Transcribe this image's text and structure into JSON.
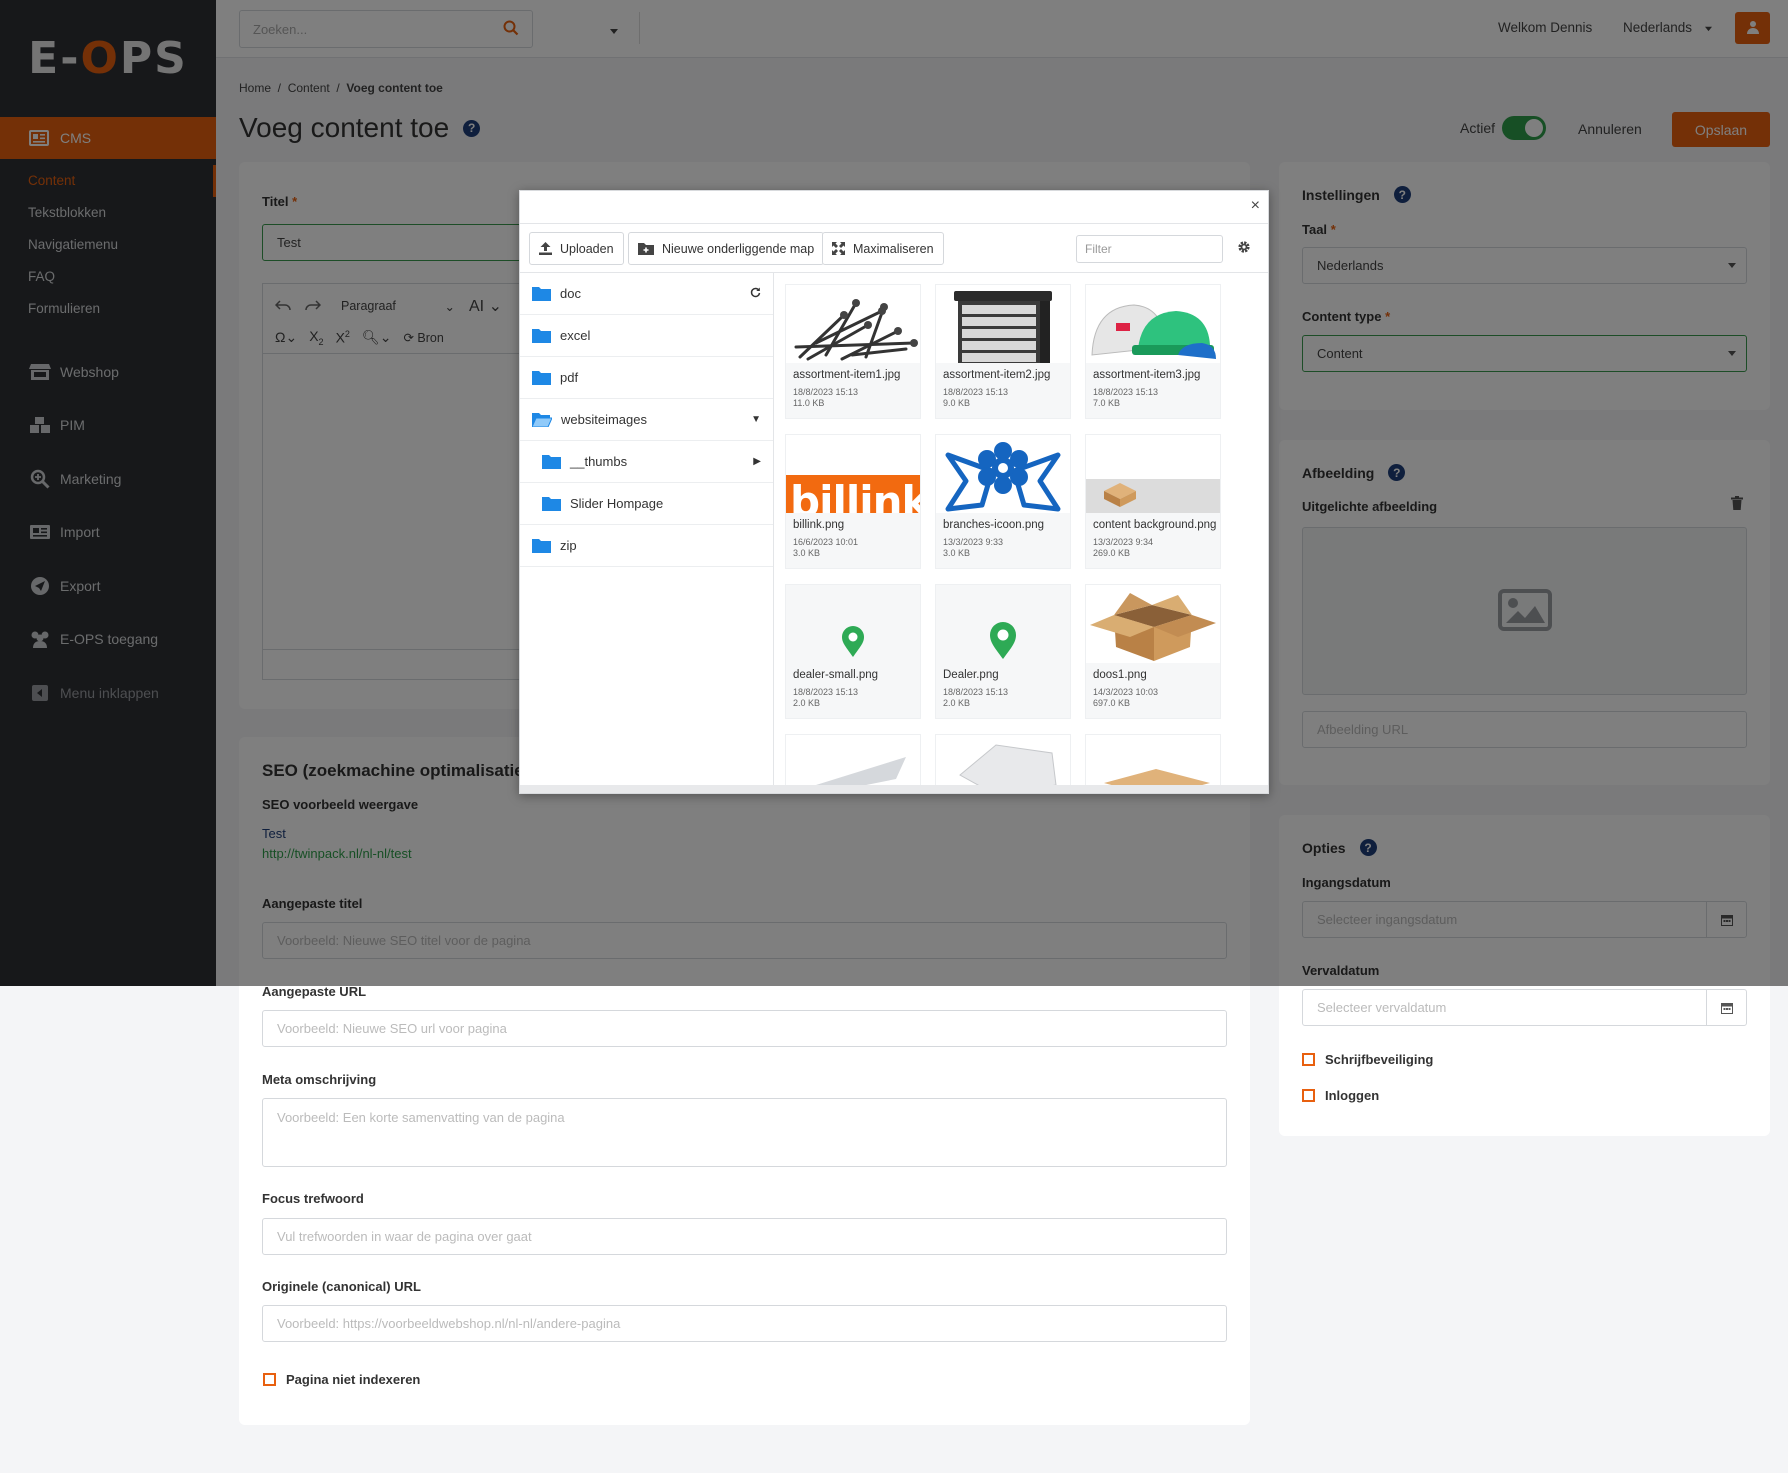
{
  "brand": {
    "logo_left": "E-",
    "logo_o": "O",
    "logo_right": "PS",
    "accent": "#e8600f",
    "sidebar_bg": "#2f3135"
  },
  "sidebar": {
    "cms_label": "CMS",
    "cms_items": [
      "Content",
      "Tekstblokken",
      "Navigatiemenu",
      "FAQ",
      "Formulieren"
    ],
    "main_items": [
      "Webshop",
      "PIM",
      "Marketing",
      "Import",
      "Export",
      "E-OPS toegang"
    ],
    "collapse_label": "Menu inklappen"
  },
  "topbar": {
    "search_placeholder": "Zoeken...",
    "welcome": "Welkom Dennis",
    "language": "Nederlands"
  },
  "breadcrumb": {
    "home": "Home",
    "content": "Content",
    "current": "Voeg content toe"
  },
  "header": {
    "title": "Voeg content toe",
    "help": "?",
    "actief_label": "Actief",
    "actief_on": true,
    "cancel": "Annuleren",
    "save": "Opslaan"
  },
  "main_form": {
    "title_label": "Titel",
    "required": "*",
    "title_value": "Test",
    "editor": {
      "paragraph": "Paragraaf",
      "font_size": "AI",
      "source": "Bron"
    }
  },
  "seo": {
    "heading": "SEO (zoekmachine optimalisatie)",
    "preview_label": "SEO voorbeeld weergave",
    "preview_title": "Test",
    "preview_url": "http://twinpack.nl/nl-nl/test",
    "custom_title_label": "Aangepaste titel",
    "custom_title_placeholder": "Voorbeeld: Nieuwe SEO titel voor de pagina",
    "custom_url_label": "Aangepaste URL",
    "custom_url_placeholder": "Voorbeeld: Nieuwe SEO url voor pagina",
    "meta_label": "Meta omschrijving",
    "meta_placeholder": "Voorbeeld: Een korte samenvatting van de pagina",
    "focus_label": "Focus trefwoord",
    "focus_placeholder": "Vul trefwoorden in waar de pagina over gaat",
    "canonical_label": "Originele (canonical) URL",
    "canonical_placeholder": "Voorbeeld: https://voorbeeldwebshop.nl/nl-nl/andere-pagina",
    "noindex_label": "Pagina niet indexeren"
  },
  "settings": {
    "heading": "Instellingen",
    "taal_label": "Taal",
    "taal_value": "Nederlands",
    "content_type_label": "Content type",
    "content_type_value": "Content"
  },
  "image_card": {
    "heading": "Afbeelding",
    "featured_label": "Uitgelichte afbeelding",
    "url_placeholder": "Afbeelding URL"
  },
  "options": {
    "heading": "Opties",
    "start_label": "Ingangsdatum",
    "start_placeholder": "Selecteer ingangsdatum",
    "end_label": "Vervaldatum",
    "end_placeholder": "Selecteer vervaldatum",
    "write_protect": "Schrijfbeveiliging",
    "login": "Inloggen"
  },
  "modal": {
    "close": "×",
    "upload": "Uploaden",
    "new_folder": "Nieuwe onderliggende map",
    "maximize": "Maximaliseren",
    "filter_placeholder": "Filter",
    "folders": [
      {
        "name": "doc"
      },
      {
        "name": "excel"
      },
      {
        "name": "pdf"
      },
      {
        "name": "websiteimages"
      },
      {
        "name": "__thumbs"
      },
      {
        "name": "Slider Hompage"
      },
      {
        "name": "zip"
      }
    ],
    "files": [
      {
        "name": "assortment-item1.jpg",
        "date": "18/8/2023 15:13",
        "size": "11.0 KB"
      },
      {
        "name": "assortment-item2.jpg",
        "date": "18/8/2023 15:13",
        "size": "9.0 KB"
      },
      {
        "name": "assortment-item3.jpg",
        "date": "18/8/2023 15:13",
        "size": "7.0 KB"
      },
      {
        "name": "billink.png",
        "date": "16/6/2023 10:01",
        "size": "3.0 KB"
      },
      {
        "name": "branches-icoon.png",
        "date": "13/3/2023 9:33",
        "size": "3.0 KB"
      },
      {
        "name": "content background.png",
        "date": "13/3/2023 9:34",
        "size": "269.0 KB"
      },
      {
        "name": "dealer-small.png",
        "date": "18/8/2023 15:13",
        "size": "2.0 KB"
      },
      {
        "name": "Dealer.png",
        "date": "18/8/2023 15:13",
        "size": "2.0 KB"
      },
      {
        "name": "doos1.png",
        "date": "14/3/2023 10:03",
        "size": "697.0 KB"
      }
    ],
    "billink_text": "billink"
  }
}
